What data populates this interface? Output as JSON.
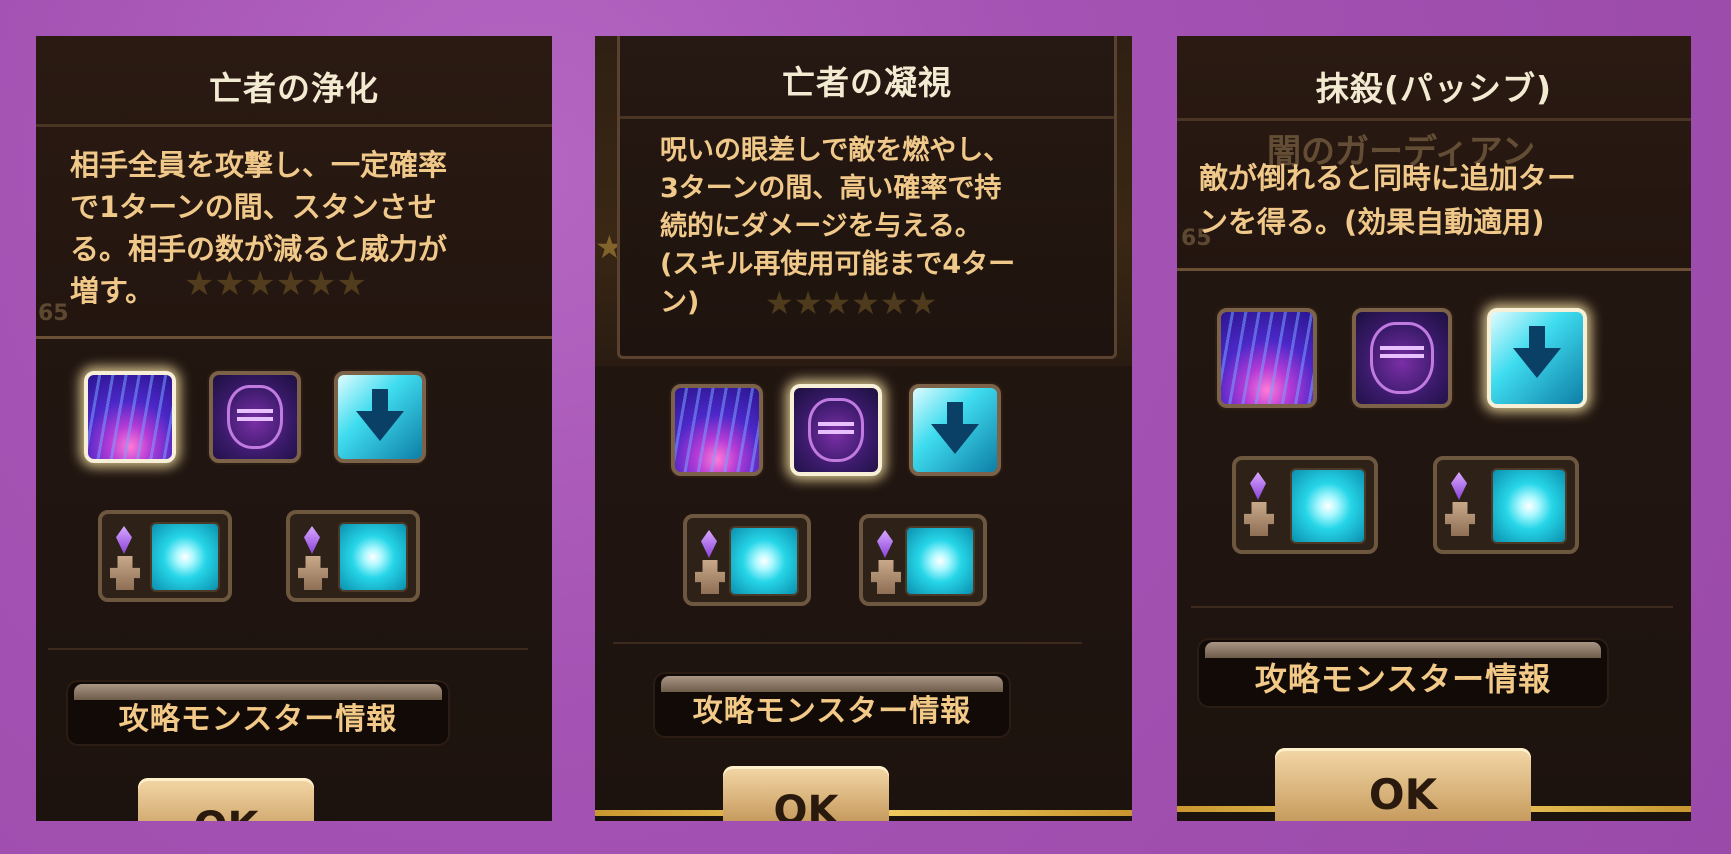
{
  "panels": [
    {
      "title": "亡者の浄化",
      "description": [
        "相手全員を攻撃し、一定確率",
        "で1ターンの間、スタンさせ",
        "る。相手の数が減ると威力が",
        "増す。"
      ],
      "selected_skill": 1,
      "info_button": "攻略モンスター情報",
      "ok_button": "OK"
    },
    {
      "title": "亡者の凝視",
      "description": [
        "呪いの眼差しで敵を燃やし、",
        "3ターンの間、高い確率で持",
        "続的にダメージを与える。",
        "(スキル再使用可能まで4ター",
        "ン)"
      ],
      "selected_skill": 2,
      "info_button": "攻略モンスター情報",
      "ok_button": "OK"
    },
    {
      "title": "抹殺(パッシブ)",
      "description": [
        "敵が倒れると同時に追加ター",
        "ンを得る。(効果自動適用)"
      ],
      "selected_skill": 3,
      "info_button": "攻略モンスター情報",
      "ok_button": "OK",
      "background_monster": "闇のガーディアン",
      "background_level": "65"
    }
  ],
  "icons": {
    "skill_1": "purple-burst-icon",
    "skill_2": "dark-face-icon",
    "skill_3": "down-arrow-icon",
    "rune": "crystal-pedestal-icon",
    "rune_effect": "cyan-burst-icon"
  },
  "colors": {
    "background": "#a452b3",
    "panel": "#1d130e",
    "title_text": "#f3ead2",
    "description_text": "#f0c98a",
    "ok_button": "#e3c08a"
  }
}
